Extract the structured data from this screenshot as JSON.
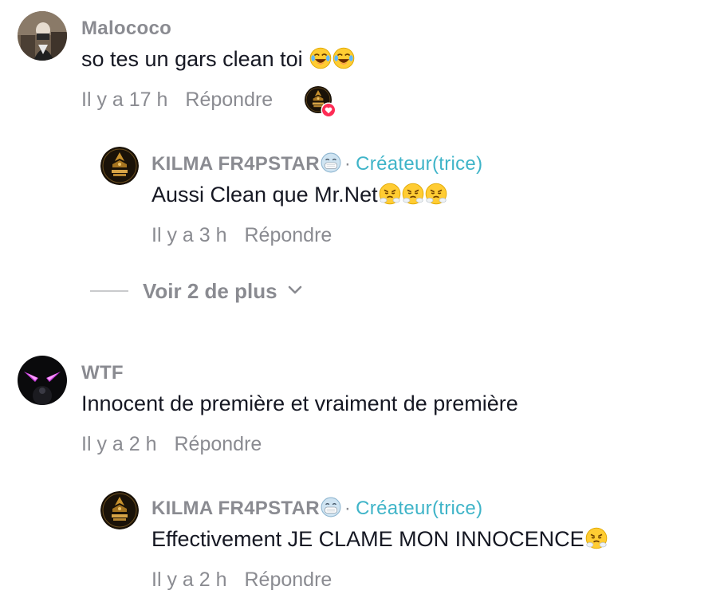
{
  "comments": [
    {
      "username": "Malococo",
      "text": "so tes un gars clean toi ",
      "emojis": "😂😂",
      "time": "Il y a 17 h",
      "reply_label": "Répondre",
      "replies": [
        {
          "username": "KILMA FR4PSTAR",
          "creator_label": "Créateur(trice)",
          "separator": "·",
          "text": "Aussi Clean que Mr.Net",
          "time": "Il y a 3 h",
          "reply_label": "Répondre"
        }
      ],
      "view_more_label": "Voir 2 de plus"
    },
    {
      "username": "WTF",
      "text": "Innocent de première et vraiment de première",
      "time": "Il y a 2 h",
      "reply_label": "Répondre",
      "replies": [
        {
          "username": "KILMA FR4PSTAR",
          "creator_label": "Créateur(trice)",
          "separator": "·",
          "text": "Effectivement JE CLAME MON INNOCENCE",
          "time": "Il y a 2 h",
          "reply_label": "Répondre"
        }
      ]
    }
  ],
  "colors": {
    "creator_accent": "#3fb4c8",
    "meta_gray": "#8a8b91",
    "heart_red": "#fe2c55"
  },
  "icons": {
    "liked_by_creator": "heart-badge-icon",
    "expand": "chevron-down-icon",
    "creator_emoji": "face-with-medical-mask-emoji",
    "steam_emoji": "face-with-steam-emoji"
  }
}
